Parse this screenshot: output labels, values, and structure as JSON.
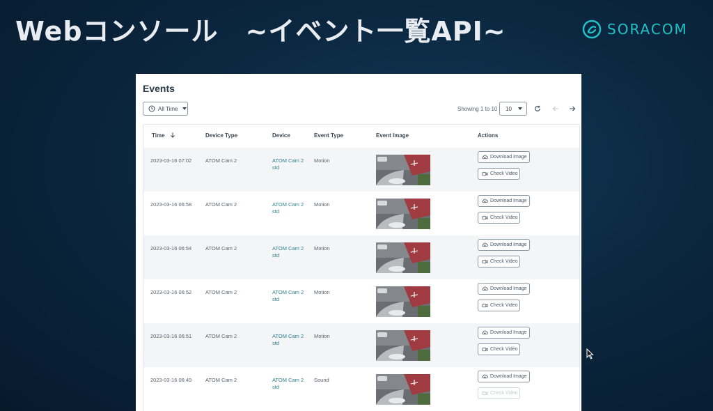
{
  "slide": {
    "title": "Webコンソール　~イベント一覧API~",
    "logo_text": "SORACOM"
  },
  "events_panel": {
    "title": "Events",
    "filter": {
      "label": "All Time",
      "icon": "clock-icon"
    },
    "pagination": {
      "showing_text": "Showing 1 to 10",
      "page_size": "10"
    },
    "columns": [
      "Time",
      "Device Type",
      "Device",
      "Event Type",
      "Event Image",
      "Actions"
    ],
    "rows": [
      {
        "time": "2023-03-16 07:02",
        "device_type": "ATOM Cam 2",
        "device": "ATOM Cam 2 std",
        "event_type": "Motion",
        "download_label": "Download Image",
        "check_label": "Check Video",
        "check_enabled": true
      },
      {
        "time": "2023-03-16 06:58",
        "device_type": "ATOM Cam 2",
        "device": "ATOM Cam 2 std",
        "event_type": "Motion",
        "download_label": "Download Image",
        "check_label": "Check Video",
        "check_enabled": true
      },
      {
        "time": "2023-03-16 06:54",
        "device_type": "ATOM Cam 2",
        "device": "ATOM Cam 2 std",
        "event_type": "Motion",
        "download_label": "Download Image",
        "check_label": "Check Video",
        "check_enabled": true
      },
      {
        "time": "2023-03-16 06:52",
        "device_type": "ATOM Cam 2",
        "device": "ATOM Cam 2 std",
        "event_type": "Motion",
        "download_label": "Download Image",
        "check_label": "Check Video",
        "check_enabled": true
      },
      {
        "time": "2023-03-16 06:51",
        "device_type": "ATOM Cam 2",
        "device": "ATOM Cam 2 std",
        "event_type": "Motion",
        "download_label": "Download Image",
        "check_label": "Check Video",
        "check_enabled": true
      },
      {
        "time": "2023-03-16 06:49",
        "device_type": "ATOM Cam 2",
        "device": "ATOM Cam 2 std",
        "event_type": "Sound",
        "download_label": "Download Image",
        "check_label": "Check Video",
        "check_enabled": false
      }
    ]
  },
  "colors": {
    "background": "#0b2740",
    "accent": "#22c3c8",
    "device_link": "#2f7f8f"
  }
}
